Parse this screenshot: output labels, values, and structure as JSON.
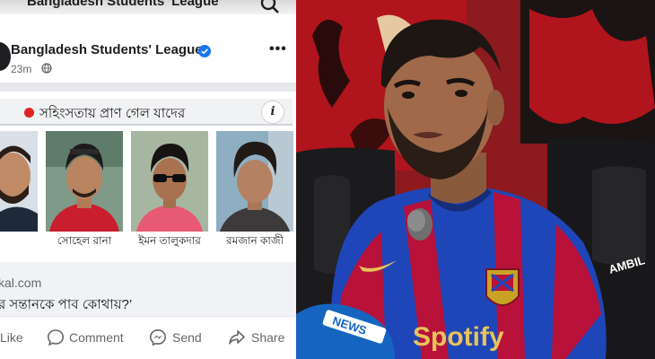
{
  "post": {
    "header_title": "Bangladesh Students' League",
    "page_name": "Bangladesh Students' League",
    "time": "23m",
    "more_label": "•••"
  },
  "card": {
    "headline": "সহিংসতায় প্রাণ গেল যাদের",
    "info_label": "i",
    "victims": [
      {
        "name": ""
      },
      {
        "name": "সোহেল রানা"
      },
      {
        "name": "ইমন তালুকদার"
      },
      {
        "name": "রমজান কাজী"
      }
    ]
  },
  "link": {
    "domain": "kal.com",
    "title": "র সন্তানকে পাব কোথায়?’"
  },
  "actions": {
    "like": "Like",
    "comment": "Comment",
    "send": "Send",
    "share": "Share"
  },
  "photo": {
    "jersey_sponsor": "Spotify",
    "jersey_brand": "AMBIL",
    "mic_label": "NEWS"
  },
  "colors": {
    "facebook_blue": "#1877f2",
    "dot_red": "#e02424",
    "jersey_blue": "#1f46b8",
    "jersey_red": "#b8123a"
  }
}
